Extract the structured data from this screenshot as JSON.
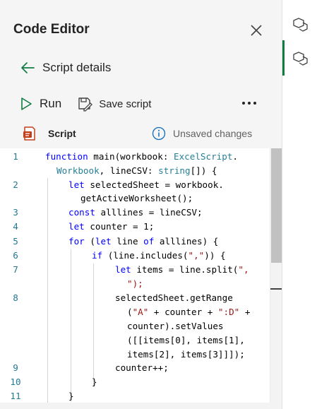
{
  "panel": {
    "title": "Code Editor",
    "back_label": "Script details",
    "run_label": "Run",
    "save_label": "Save script",
    "more_label": "•••",
    "script_label": "Script",
    "status_label": "Unsaved changes"
  },
  "sidebar": {
    "items": [
      {
        "icon": "cube-icon"
      },
      {
        "icon": "cube-icon",
        "active": true
      }
    ]
  },
  "colors": {
    "accent": "#107c41",
    "keyword": "#0000ff",
    "type": "#267f99",
    "string": "#a31515",
    "line_number": "#237893"
  },
  "editor": {
    "line_numbers": [
      "1",
      "2",
      "3",
      "4",
      "5",
      "6",
      "7",
      "8",
      "9",
      "10",
      "11"
    ],
    "lines": [
      "function main(workbook: ExcelScript.",
      "Workbook, lineCSV: string[]) {",
      "let selectedSheet = workbook.",
      "getActiveWorksheet();",
      "const alllines = lineCSV;",
      "let counter = 1;",
      "for (let line of alllines) {",
      "if (line.includes(\",\")) {",
      "let items = line.split(\",",
      "\");",
      "selectedSheet.getRange",
      "(\"A\" + counter + \":D\" +",
      "counter).setValues",
      "([[items[0], items[1],",
      "items[2], items[3]]]);",
      "counter++;",
      "}",
      "}"
    ]
  }
}
